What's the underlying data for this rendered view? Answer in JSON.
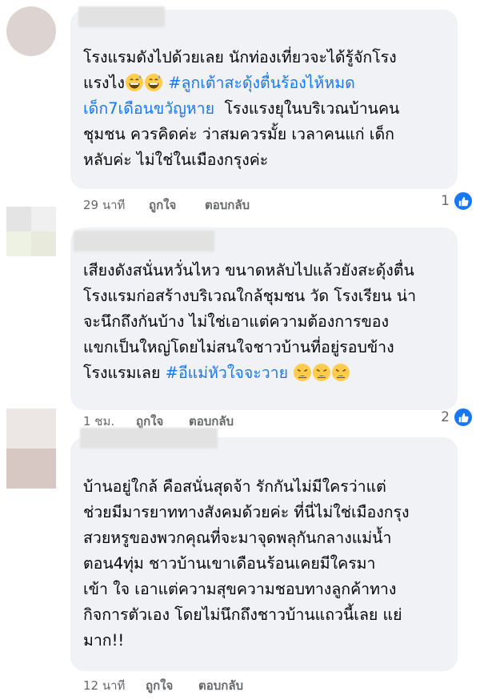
{
  "comments": [
    {
      "text_parts": [
        {
          "t": "โรงแรมดังไปด้วยเลย นักท่องเที่ยวจะได้รู้จักโรง\nแรงไง"
        },
        {
          "emoji": "grinning-sweat"
        },
        {
          "emoji": "grinning-sweat"
        },
        {
          "t": " "
        },
        {
          "t": "#ลูกเต้าสะดุ้งตื่นร้องไห้หมด\nเด็ก7เดือนขวัญหาย",
          "tag": true
        },
        {
          "t": "  โรงแรงยุในบริเวณบ้านคน\nชุมชน ควรคิดค่ะ ว่าสมควรมั้ย เวลาคนแก่ เด็ก\nหลับค่ะ ไม่ใช่ในเมืองกรุงค่ะ"
        }
      ],
      "time": "29 นาที",
      "like": "ถูกใจ",
      "reply": "ตอบกลับ",
      "reaction_count": "1"
    },
    {
      "text_parts": [
        {
          "t": "เสียงดังสนั่นหวั่นไหว ขนาดหลับไปแล้วยังสะดุ้งตื่น\nโรงแรมก่อสร้างบริเวณใกล้ชุมชน วัด โรงเรียน น่า\nจะนึกถึงกันบ้าง ไม่ใช่เอาแต่ความต้องการของ\nแขกเป็นใหญ่โดยไม่สนใจชาวบ้านที่อยู่รอบข้าง\nโรงแรมเลย "
        },
        {
          "t": "#อีแม่หัวใจจะวาย",
          "tag": true
        },
        {
          "t": " "
        },
        {
          "emoji": "weary"
        },
        {
          "emoji": "weary"
        },
        {
          "emoji": "weary"
        }
      ],
      "time": "1 ชม.",
      "like": "ถูกใจ",
      "reply": "ตอบกลับ",
      "reaction_count": "2"
    },
    {
      "text_parts": [
        {
          "t": "บ้านอยู่ใกล้ คือสนั่นสุดจ้า รักกันไม่มีใครว่าแต่\nช่วยมีมารยาททางสังคมด้วยค่ะ ที่นี่ไม่ใช่เมืองกรุง\nสวยหรูของพวกคุณที่จะมาจุดพลุกันกลางแม่น้ำ\nตอน4ทุ่ม ชาวบ้านเขาเดือนร้อนเคยมีใครมา\nเข้า ใจ เอาแต่ความสุขความชอบทางลูกค้าทาง\nกิจการตัวเอง โดยไม่นึกถึงชาวบ้านแถวนี้เลย แย่\nมาก!!"
        }
      ],
      "time": "12 นาที",
      "like": "ถูกใจ",
      "reply": "ตอบกลับ",
      "reaction_count": ""
    }
  ],
  "colors": {
    "bubble": "#f0f2f5",
    "link": "#1877f2",
    "meta": "#65676b",
    "like_blue": "#1877f2"
  }
}
